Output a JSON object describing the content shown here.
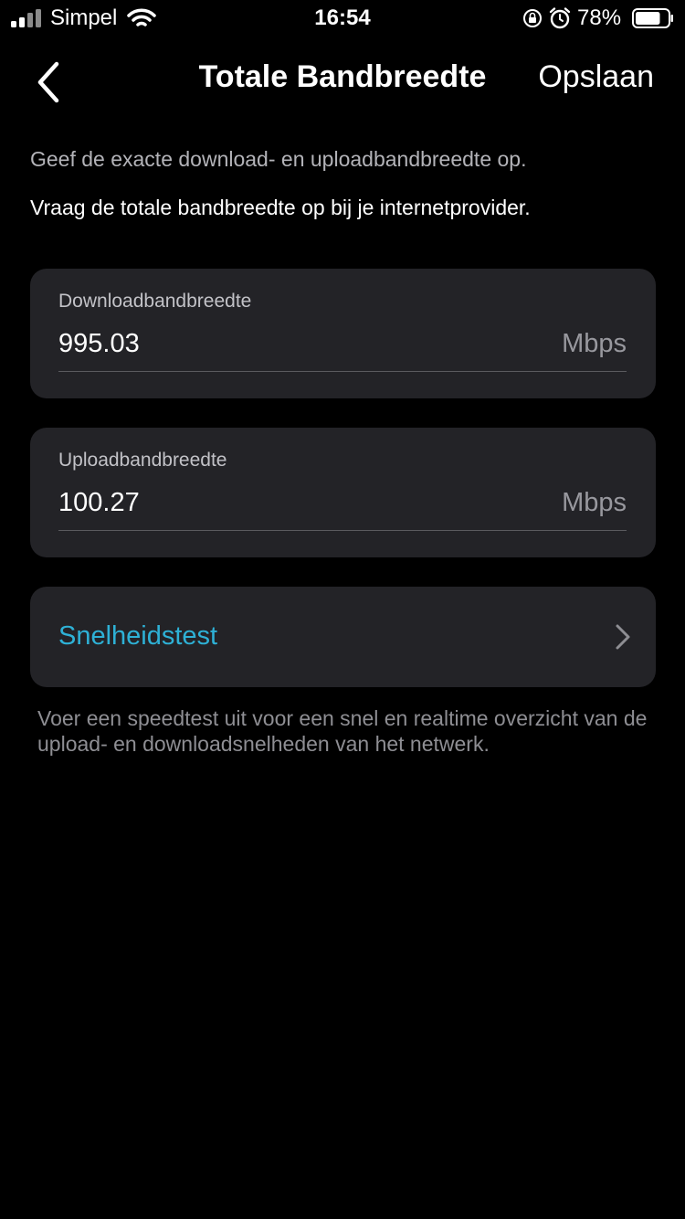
{
  "status_bar": {
    "carrier": "Simpel",
    "time": "16:54",
    "battery_percent": "78%",
    "battery_level": 0.78,
    "icons": [
      "signal-icon",
      "wifi-icon",
      "orientation-lock-icon",
      "alarm-icon",
      "battery-icon"
    ]
  },
  "nav": {
    "title": "Totale Bandbreedte",
    "save_label": "Opslaan",
    "back_icon": "chevron-left-icon"
  },
  "description": {
    "line1": "Geef de exacte download- en uploadbandbreedte op.",
    "line2": "Vraag de totale bandbreedte op bij je internetprovider."
  },
  "download": {
    "label": "Downloadbandbreedte",
    "value": "995.03",
    "unit": "Mbps"
  },
  "upload": {
    "label": "Uploadbandbreedte",
    "value": "100.27",
    "unit": "Mbps"
  },
  "speedtest": {
    "label": "Snelheidstest",
    "icon": "chevron-right-icon",
    "note": "Voer een speedtest uit voor een snel en realtime overzicht van de upload- en downloadsnelheden van het netwerk."
  },
  "colors": {
    "background": "#000000",
    "card": "#232327",
    "accent": "#2eb1d6",
    "secondary_text": "#8e8e93"
  }
}
